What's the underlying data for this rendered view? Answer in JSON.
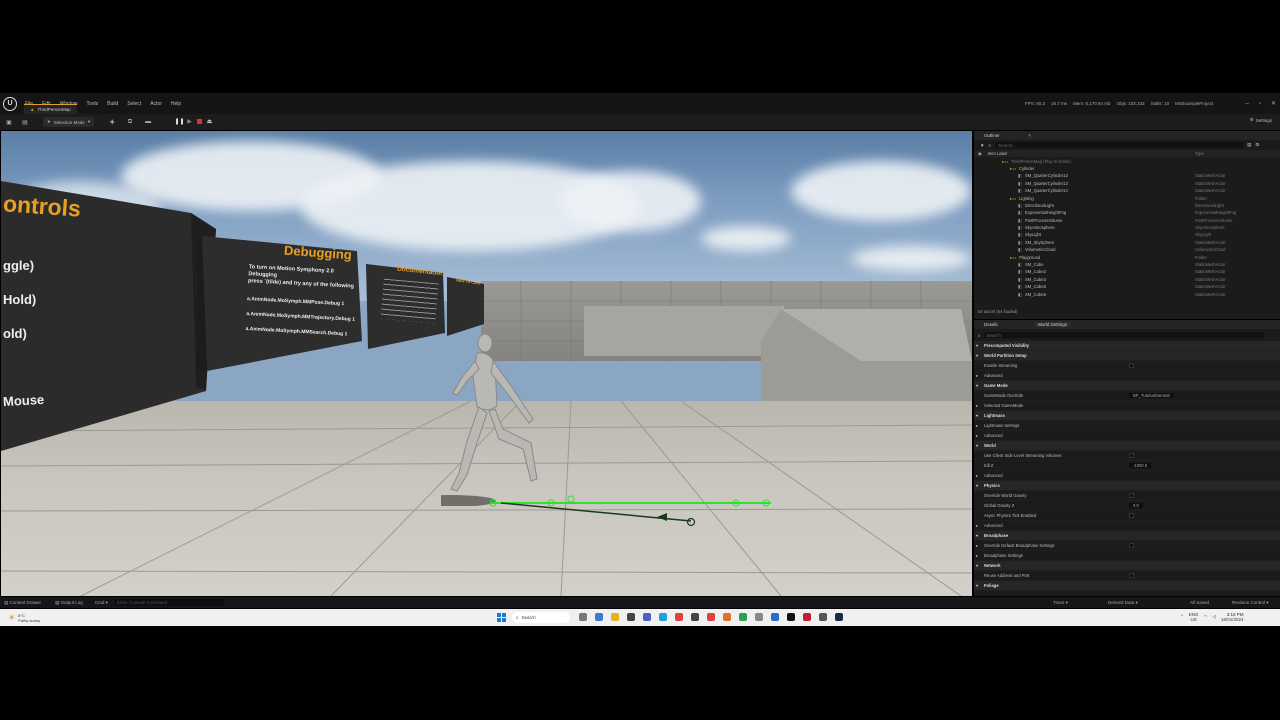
{
  "menu": {
    "items": [
      "File",
      "Edit",
      "Window",
      "Tools",
      "Build",
      "Select",
      "Actor",
      "Help"
    ],
    "map_tab": "ThirdPersonMap"
  },
  "stats": {
    "fps": "FPS: 60.3",
    "ms": "16.7 ms",
    "mem": "Mem: 6,170.94 mb",
    "objs": "Objs: 102,232",
    "stalls": "Stalls: 10",
    "project": "MSExampleProject"
  },
  "toolbar": {
    "selection_mode": "Selection Mode",
    "settings": "Settings"
  },
  "viewport": {
    "billboard_main": [
      "ontrols",
      "ggle)",
      "Hold)",
      "old)",
      "Mouse"
    ],
    "debugging": {
      "title": "Debugging",
      "lines": [
        "To turn on Motion Symphony 2.0 Debugging",
        "press `(tilde) and try any of the following",
        "a.AnimNode.MoSymph.MMPose.Debug 1",
        "a.AnimNode.MoSymph.MMTrajectory.Debug 1",
        "a.AnimNode.MoSymph.MMSearch.Debug 1",
        "a.AnimNode.MoSymph.MMSearch.Debug 1"
      ]
    },
    "documentation": {
      "title": "Documentation"
    },
    "howto": {
      "title": "How To Com"
    }
  },
  "outliner": {
    "tab": "Outliner",
    "search_placeholder": "Search...",
    "col_label": "Item Label",
    "col_type": "Type",
    "rows": [
      {
        "label": "ThirdPersonMap (Play In Editor)",
        "type": "",
        "indent": 0
      },
      {
        "label": "Cylinder",
        "type": "",
        "indent": 1
      },
      {
        "label": "SM_QuarterCylinder12",
        "type": "StaticMeshActor",
        "indent": 2
      },
      {
        "label": "SM_QuarterCylinder13",
        "type": "StaticMeshActor",
        "indent": 2
      },
      {
        "label": "SM_QuarterCylinder14",
        "type": "StaticMeshActor",
        "indent": 2
      },
      {
        "label": "Lighting",
        "type": "Folder",
        "indent": 1
      },
      {
        "label": "DirectionalLight",
        "type": "DirectionalLight",
        "indent": 2
      },
      {
        "label": "ExponentialHeightFog",
        "type": "ExponentialHeightFog",
        "indent": 2
      },
      {
        "label": "PostProcessVolume",
        "type": "PostProcessVolume",
        "indent": 2
      },
      {
        "label": "SkyAtmosphere",
        "type": "SkyAtmosphere",
        "indent": 2
      },
      {
        "label": "SkyLight",
        "type": "SkyLight",
        "indent": 2
      },
      {
        "label": "SM_SkySphere",
        "type": "StaticMeshActor",
        "indent": 2
      },
      {
        "label": "VolumetricCloud",
        "type": "VolumetricCloud",
        "indent": 2
      },
      {
        "label": "Playground",
        "type": "Folder",
        "indent": 1
      },
      {
        "label": "SM_Cube",
        "type": "StaticMeshActor",
        "indent": 2
      },
      {
        "label": "SM_Cube2",
        "type": "StaticMeshActor",
        "indent": 2
      },
      {
        "label": "SM_Cube3",
        "type": "StaticMeshActor",
        "indent": 2
      },
      {
        "label": "SM_Cube5",
        "type": "StaticMeshActor",
        "indent": 2
      },
      {
        "label": "SM_Cube6",
        "type": "StaticMeshActor",
        "indent": 2
      }
    ],
    "footer": "54 actors (54 loaded)"
  },
  "details": {
    "tab": "Details",
    "tab2": "World Settings",
    "search_placeholder": "Search",
    "rows": [
      {
        "label": "Precomputed Visibility",
        "section": true,
        "value": ""
      },
      {
        "label": "World Partition Setup",
        "section": true,
        "value": ""
      },
      {
        "label": "Enable Streaming",
        "section": false,
        "value": "checkbox"
      },
      {
        "label": "Advanced",
        "section": false,
        "value": ""
      },
      {
        "label": "Game Mode",
        "section": true,
        "value": ""
      },
      {
        "label": "GameMode Override",
        "section": false,
        "value": "BP_TutorialGameM"
      },
      {
        "label": "Selected GameMode",
        "section": false,
        "value": ""
      },
      {
        "label": "Lightmass",
        "section": true,
        "value": ""
      },
      {
        "label": "Lightmass Settings",
        "section": false,
        "value": ""
      },
      {
        "label": "Advanced",
        "section": false,
        "value": ""
      },
      {
        "label": "World",
        "section": true,
        "value": ""
      },
      {
        "label": "Use Client Side Level Streaming Volumes",
        "section": false,
        "value": "checkbox"
      },
      {
        "label": "Kill Z",
        "section": false,
        "value": "-1000.0"
      },
      {
        "label": "Advanced",
        "section": false,
        "value": ""
      },
      {
        "label": "Physics",
        "section": true,
        "value": ""
      },
      {
        "label": "Override World Gravity",
        "section": false,
        "value": "checkbox"
      },
      {
        "label": "Global Gravity Z",
        "section": false,
        "value": "0.0"
      },
      {
        "label": "Async Physics Tick Enabled",
        "section": false,
        "value": "checkbox"
      },
      {
        "label": "Advanced",
        "section": false,
        "value": ""
      },
      {
        "label": "Broadphase",
        "section": true,
        "value": ""
      },
      {
        "label": "Override Default Broadphase Settings",
        "section": false,
        "value": "checkbox"
      },
      {
        "label": "Broadphase Settings",
        "section": false,
        "value": ""
      },
      {
        "label": "Network",
        "section": true,
        "value": ""
      },
      {
        "label": "Reuse Address and Port",
        "section": false,
        "value": "checkbox"
      },
      {
        "label": "Foliage",
        "section": true,
        "value": ""
      }
    ]
  },
  "statusbar": {
    "content_drawer": "Content Drawer",
    "output_log": "Output Log",
    "cmd": "Cmd",
    "console_placeholder": "Enter Console Command",
    "trace": "Trace",
    "derived": "Derived Data",
    "saved": "All Saved",
    "revision": "Revision Control"
  },
  "taskbar": {
    "weather_temp": "6°C",
    "weather_desc": "Partly sunny",
    "search": "Search",
    "lang": "ENG",
    "region": "US",
    "time": "3:18 PM",
    "date": "16/01/2024"
  }
}
